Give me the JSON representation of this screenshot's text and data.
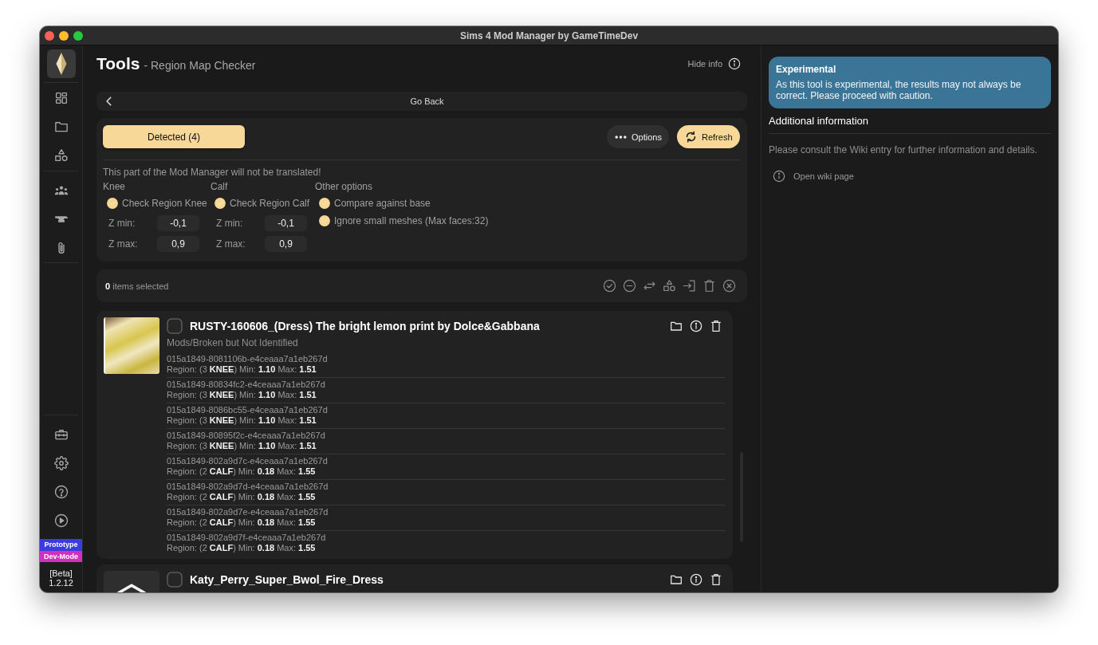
{
  "window": {
    "title": "Sims 4 Mod Manager by GameTimeDev"
  },
  "sidebar": {
    "badges": [
      {
        "label": "Prototype",
        "color": "#3b3be0"
      },
      {
        "label": "Dev-Mode",
        "color": "#d02fbf"
      }
    ],
    "version_tag": "[Beta]",
    "version": "1.2.12"
  },
  "header": {
    "title": "Tools",
    "subtitle": "- Region Map Checker",
    "hide_info": "Hide info"
  },
  "back_bar": {
    "label": "Go Back"
  },
  "checker": {
    "tabs": [
      {
        "label": "Detected (4)",
        "selected": true
      }
    ],
    "options_button": "Options",
    "refresh_button": "Refresh",
    "notice": "This part of the Mod Manager will not be translated!",
    "columns": [
      {
        "heading": "Knee",
        "checks": [
          {
            "label": "Check Region Knee",
            "checked": true
          }
        ],
        "fields": [
          {
            "label": "Z min:",
            "value": "-0,1"
          },
          {
            "label": "Z max:",
            "value": "0,9"
          }
        ]
      },
      {
        "heading": "Calf",
        "checks": [
          {
            "label": "Check Region Calf",
            "checked": true
          }
        ],
        "fields": [
          {
            "label": "Z min:",
            "value": "-0,1"
          },
          {
            "label": "Z max:",
            "value": "0,9"
          }
        ]
      },
      {
        "heading": "Other options",
        "checks": [
          {
            "label": "Compare against base",
            "checked": true
          },
          {
            "label": "Ignore small meshes (Max faces:32)",
            "checked": true
          }
        ]
      }
    ]
  },
  "selection": {
    "text": "**0** items selected"
  },
  "items": [
    {
      "kind": "photo",
      "title": "RUSTY-160606_(Dress) The bright lemon print by Dolce&Gabbana",
      "selected": false,
      "path": "Mods/Broken but Not Identified",
      "entries": [
        {
          "id": "015a1849-8081106b-e4ceaaa7a1eb267d",
          "region": "Region: (3 **KNEE**) Min: **1.10** Max: **1.51**"
        },
        {
          "id": "015a1849-80834fc2-e4ceaaa7a1eb267d",
          "region": "Region: (3 **KNEE**) Min: **1.10** Max: **1.51**"
        },
        {
          "id": "015a1849-8086bc55-e4ceaaa7a1eb267d",
          "region": "Region: (3 **KNEE**) Min: **1.10** Max: **1.51**"
        },
        {
          "id": "015a1849-80895f2c-e4ceaaa7a1eb267d",
          "region": "Region: (3 **KNEE**) Min: **1.10** Max: **1.51**"
        },
        {
          "id": "015a1849-802a9d7c-e4ceaaa7a1eb267d",
          "region": "Region: (2 **CALF**) Min: **0.18** Max: **1.55**"
        },
        {
          "id": "015a1849-802a9d7d-e4ceaaa7a1eb267d",
          "region": "Region: (2 **CALF**) Min: **0.18** Max: **1.55**"
        },
        {
          "id": "015a1849-802a9d7e-e4ceaaa7a1eb267d",
          "region": "Region: (2 **CALF**) Min: **0.18** Max: **1.55**"
        },
        {
          "id": "015a1849-802a9d7f-e4ceaaa7a1eb267d",
          "region": "Region: (2 **CALF**) Min: **0.18** Max: **1.55**"
        }
      ]
    },
    {
      "kind": "placeholder",
      "title": "Katy_Perry_Super_Bwol_Fire_Dress",
      "selected": false
    }
  ],
  "info_panel": {
    "alert": {
      "title": "Experimental",
      "text": "As this tool is experimental, the results may not always be correct. Please proceed with caution."
    },
    "heading": "Additional information",
    "text": "Please consult the Wiki entry for further information and details.",
    "link": "Open wiki page"
  }
}
